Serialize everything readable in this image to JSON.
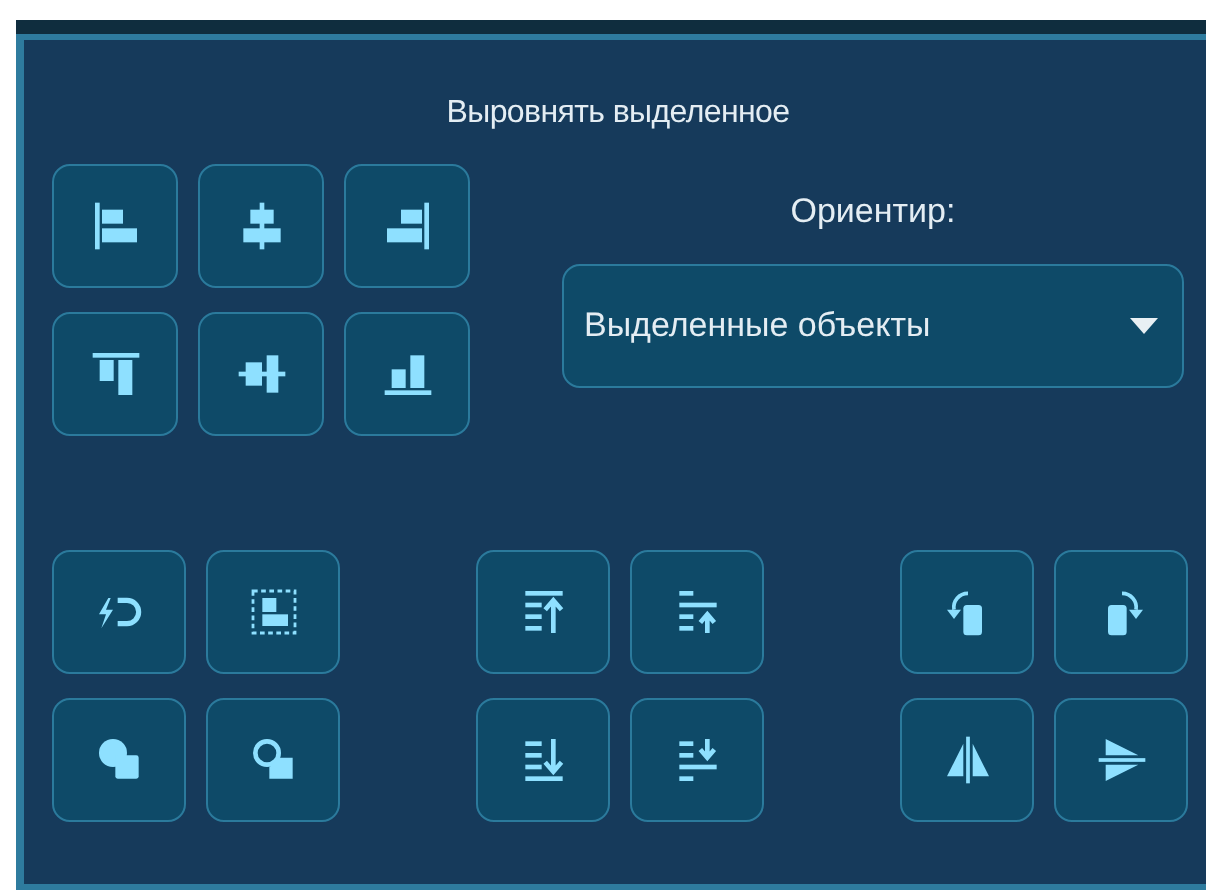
{
  "panel": {
    "title": "Выровнять выделенное"
  },
  "reference": {
    "label": "Ориентир:",
    "value": "Выделенные объекты"
  }
}
